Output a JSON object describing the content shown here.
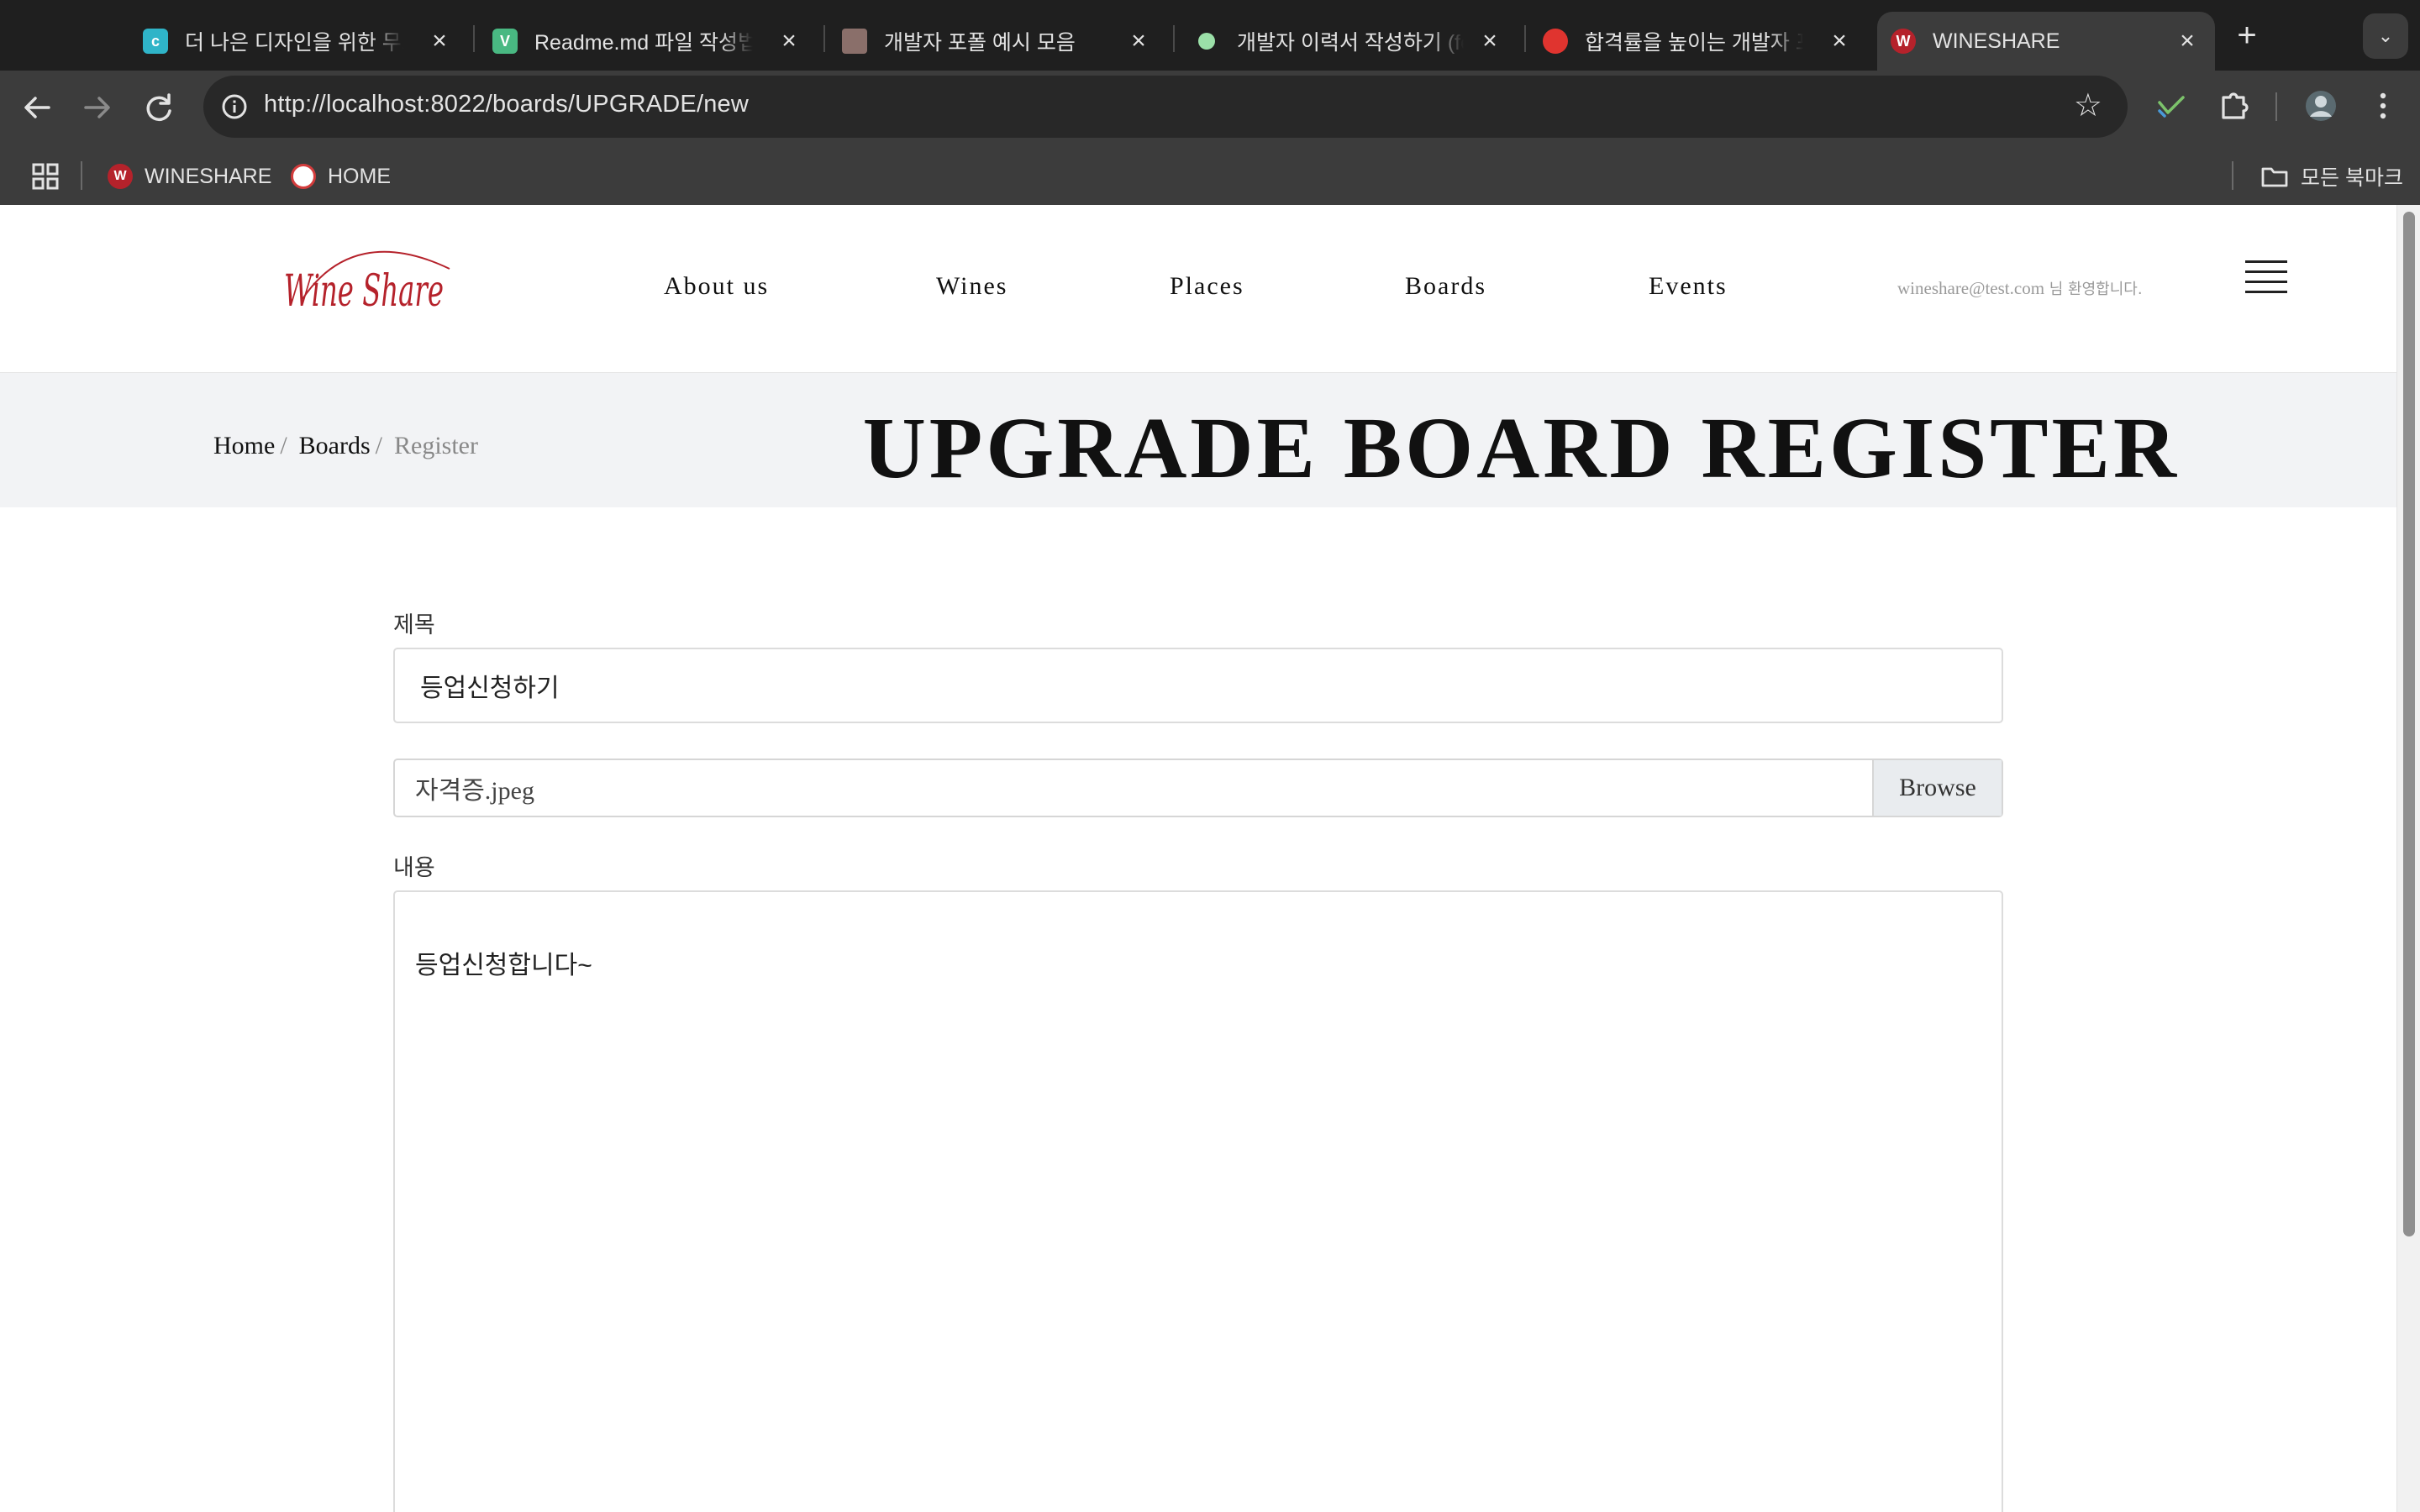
{
  "browser": {
    "tabs": [
      {
        "title": "더 나은 디자인을 위한 무료 툴",
        "favicon_color": "#2fb4c8",
        "favicon_glyph": "c"
      },
      {
        "title": "Readme.md 파일 작성법",
        "favicon_color": "#49b882",
        "favicon_glyph": "V"
      },
      {
        "title": "개발자 포폴 예시 모음",
        "favicon_color": "#8a6f6a",
        "favicon_glyph": ""
      },
      {
        "title": "개발자 이력서 작성하기 (feat",
        "favicon_color": "#9be0a8",
        "favicon_glyph": ""
      },
      {
        "title": "합격률을 높이는 개발자 포트",
        "favicon_color": "#e0342f",
        "favicon_glyph": ""
      },
      {
        "title": "WINESHARE",
        "favicon_color": "#b5222b",
        "favicon_glyph": "W"
      }
    ],
    "url_host": "http://localhost",
    "url_rest": ":8022/boards/UPGRADE/new",
    "bookmarks": [
      {
        "label": "WINESHARE",
        "favicon_color": "#b5222b",
        "glyph": "W"
      },
      {
        "label": "HOME",
        "favicon_color": "#d33c3c",
        "glyph": ""
      }
    ],
    "all_bookmarks_label": "모든 북마크"
  },
  "site": {
    "logo_text": "Wine Share",
    "nav": [
      "About us",
      "Wines",
      "Places",
      "Boards",
      "Events"
    ],
    "welcome_email": "wineshare@test.com",
    "welcome_suffix": " 님 환영합니다."
  },
  "hero": {
    "crumb_home": "Home",
    "crumb_boards": "Boards",
    "crumb_current": "Register",
    "crumb_sep": "/",
    "title": "UPGRADE BOARD REGISTER"
  },
  "form": {
    "title_label": "제목",
    "title_value": "등업신청하기",
    "file_name": "자격증.jpeg",
    "browse_label": "Browse",
    "content_label": "내용",
    "content_value": "등업신청합니다~"
  },
  "colors": {
    "brand_red": "#b5222b",
    "hero_bg": "#f2f3f5"
  }
}
